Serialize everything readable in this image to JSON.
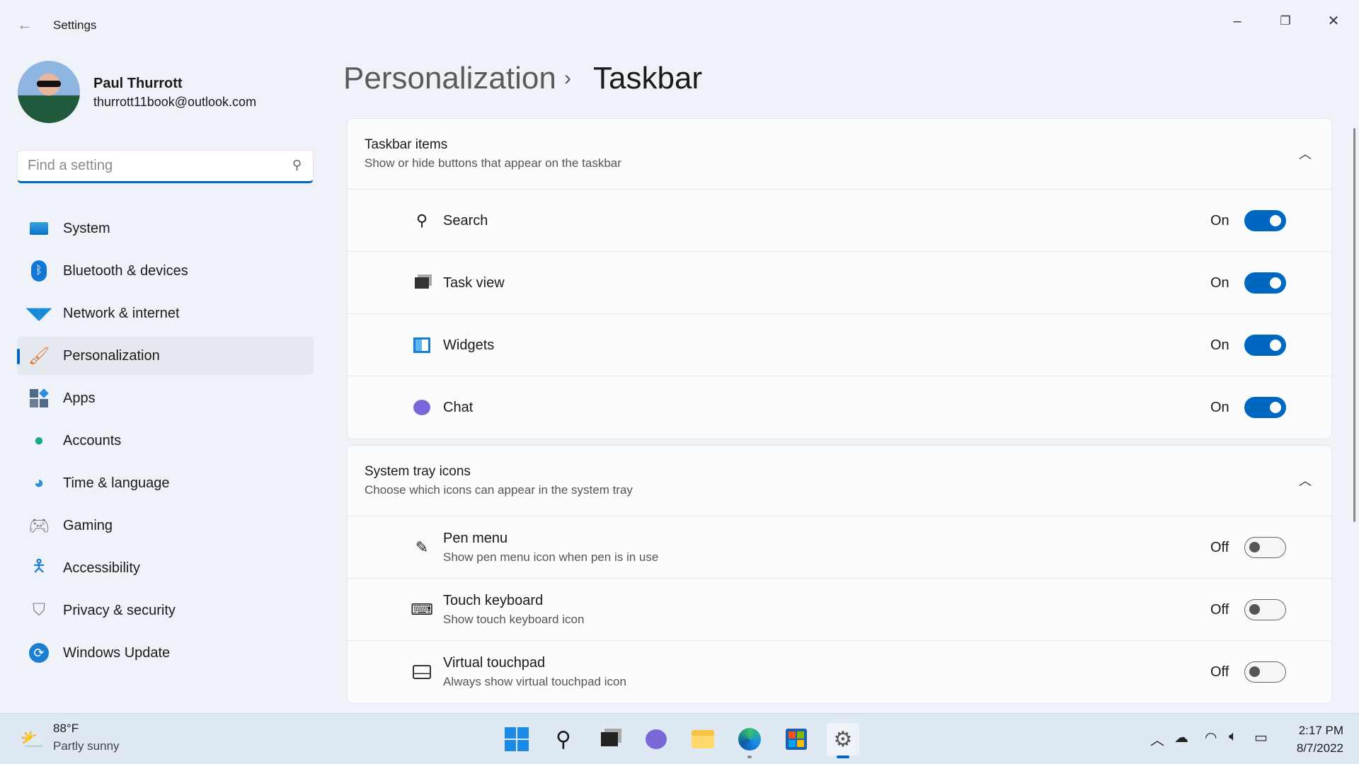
{
  "window": {
    "title": "Settings"
  },
  "user": {
    "name": "Paul Thurrott",
    "email": "thurrott11book@outlook.com"
  },
  "search": {
    "placeholder": "Find a setting"
  },
  "nav": [
    {
      "label": "System",
      "icon": "monitor-icon"
    },
    {
      "label": "Bluetooth & devices",
      "icon": "bluetooth-icon"
    },
    {
      "label": "Network & internet",
      "icon": "wifi-icon"
    },
    {
      "label": "Personalization",
      "icon": "brush-icon",
      "selected": true
    },
    {
      "label": "Apps",
      "icon": "apps-icon"
    },
    {
      "label": "Accounts",
      "icon": "person-icon"
    },
    {
      "label": "Time & language",
      "icon": "globe-clock-icon"
    },
    {
      "label": "Gaming",
      "icon": "gamepad-icon"
    },
    {
      "label": "Accessibility",
      "icon": "accessibility-icon"
    },
    {
      "label": "Privacy & security",
      "icon": "shield-icon"
    },
    {
      "label": "Windows Update",
      "icon": "update-icon"
    }
  ],
  "breadcrumb": {
    "parent": "Personalization",
    "separator": "›",
    "current": "Taskbar"
  },
  "sections": [
    {
      "title": "Taskbar items",
      "subtitle": "Show or hide buttons that appear on the taskbar",
      "rows": [
        {
          "label": "Search",
          "state": "On"
        },
        {
          "label": "Task view",
          "state": "On"
        },
        {
          "label": "Widgets",
          "state": "On"
        },
        {
          "label": "Chat",
          "state": "On"
        }
      ]
    },
    {
      "title": "System tray icons",
      "subtitle": "Choose which icons can appear in the system tray",
      "rows": [
        {
          "label": "Pen menu",
          "sub": "Show pen menu icon when pen is in use",
          "state": "Off"
        },
        {
          "label": "Touch keyboard",
          "sub": "Show touch keyboard icon",
          "state": "Off"
        },
        {
          "label": "Virtual touchpad",
          "sub": "Always show virtual touchpad icon",
          "state": "Off"
        }
      ]
    }
  ],
  "taskbar": {
    "weather": {
      "temp": "88°F",
      "condition": "Partly sunny"
    },
    "clock": {
      "time": "2:17 PM",
      "date": "8/7/2022"
    }
  },
  "colors": {
    "accent": "#0067c0"
  }
}
